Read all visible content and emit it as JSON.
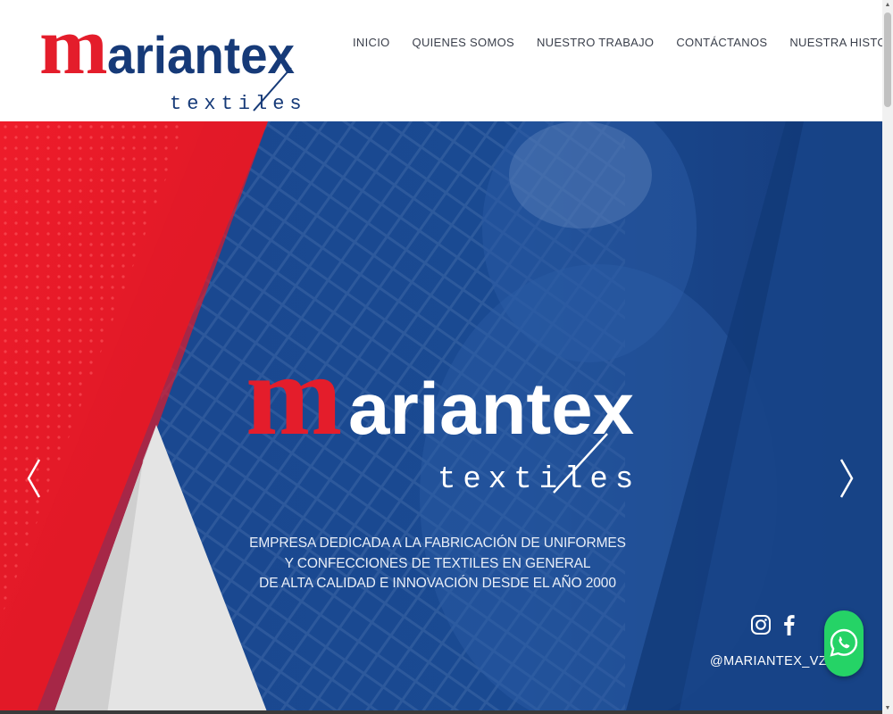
{
  "brand": {
    "wordmark": "ariantex",
    "subtitle": "textiles",
    "colors": {
      "red": "#e41d2b",
      "navy": "#163a78",
      "blue": "#1b4a93"
    }
  },
  "nav": {
    "items": [
      {
        "label": "INICIO"
      },
      {
        "label": "QUIENES SOMOS"
      },
      {
        "label": "NUESTRO TRABAJO"
      },
      {
        "label": "CONTÁCTANOS"
      },
      {
        "label": "NUESTRA HISTORIA"
      }
    ]
  },
  "hero": {
    "tagline": [
      "EMPRESA DEDICADA A LA FABRICACIÓN DE UNIFORMES",
      "Y CONFECCIONES DE TEXTILES EN GENERAL",
      "DE ALTA CALIDAD E INNOVACIÓN DESDE EL AÑO 2000"
    ],
    "social_handle": "@MARIANTEX_VZLA",
    "icons": {
      "prev": "chevron-left-icon",
      "next": "chevron-right-icon",
      "instagram": "instagram-icon",
      "facebook": "facebook-icon",
      "whatsapp": "whatsapp-icon"
    }
  }
}
